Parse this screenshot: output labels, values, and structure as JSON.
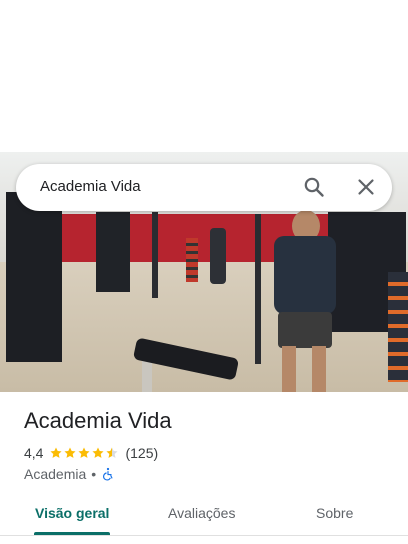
{
  "search": {
    "query": "Academia Vida"
  },
  "place": {
    "title": "Academia Vida",
    "rating": "4,4",
    "rating_value": 4.4,
    "reviews": "(125)",
    "category": "Academia",
    "separator": "•",
    "accessibility_icon": "wheelchair-icon"
  },
  "tabs": [
    {
      "label": "Visão geral",
      "active": true
    },
    {
      "label": "Avaliações",
      "active": false
    },
    {
      "label": "Sobre",
      "active": false
    }
  ],
  "colors": {
    "accent": "#0b6f68",
    "star": "#fbbc04",
    "accessibility": "#1a73e8"
  }
}
